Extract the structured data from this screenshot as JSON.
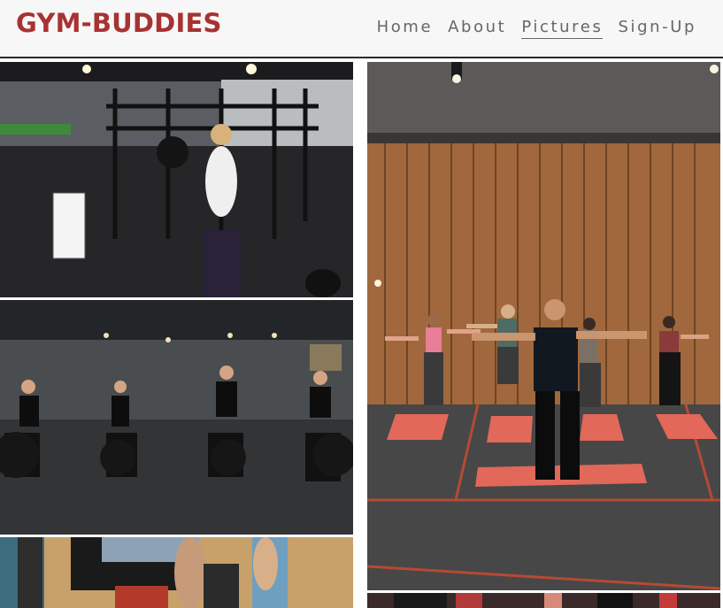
{
  "brand": "GYM-BUDDIES",
  "nav": {
    "items": [
      {
        "label": "Home",
        "active": false
      },
      {
        "label": "About",
        "active": false
      },
      {
        "label": "Pictures",
        "active": true
      },
      {
        "label": "Sign-Up",
        "active": false
      }
    ]
  },
  "colors": {
    "brand": "#a83232",
    "nav_text": "#666666",
    "header_bg": "#f7f7f7"
  },
  "gallery": {
    "photos": [
      {
        "name": "gym-photo-battle-ropes"
      },
      {
        "name": "gym-photo-spin-class"
      },
      {
        "name": "gym-photo-training-closeup"
      },
      {
        "name": "gym-photo-stretching-class"
      },
      {
        "name": "gym-photo-partial-bottom"
      }
    ]
  }
}
